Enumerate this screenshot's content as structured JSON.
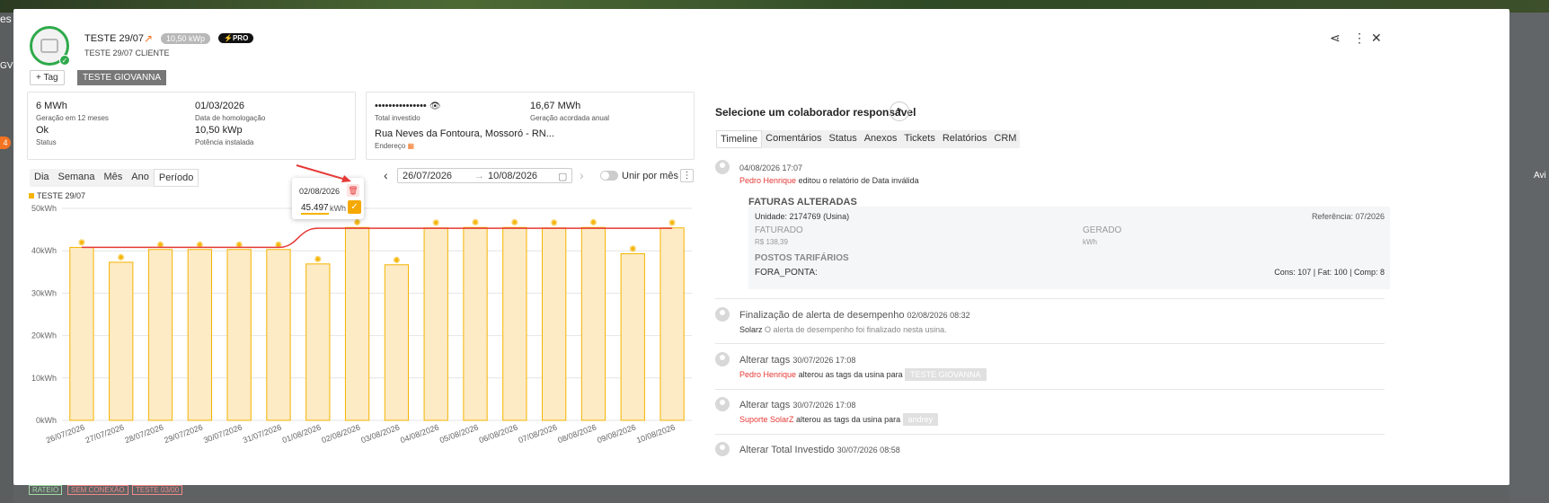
{
  "header": {
    "title": "TESTE 29/07",
    "power_badge": "10,50 kWp",
    "plan_badge": "PRO",
    "client": "TESTE 29/07 CLIENTE",
    "tag_add_label": "Tag",
    "tag": "TESTE GIOVANNA"
  },
  "card1": {
    "gen12_value": "6 MWh",
    "gen12_label": "Geração em 12 meses",
    "homolog_value": "01/03/2026",
    "homolog_label": "Data de homologação",
    "status_value": "Ok",
    "status_label": "Status",
    "power_value": "10,50 kWp",
    "power_label": "Potência instalada"
  },
  "card2": {
    "invest_value": "•••••••••••••••",
    "invest_label": "Total investido",
    "agreed_value": "16,67 MWh",
    "agreed_label": "Geração acordada anual",
    "address_value": "Rua Neves da Fontoura, Mossoró - RN...",
    "address_label": "Endereço"
  },
  "controls": {
    "periods": [
      "Dia",
      "Semana",
      "Mês",
      "Ano",
      "Período"
    ],
    "date_from": "26/07/2026",
    "date_to": "10/08/2026",
    "group_label": "Unir por mês"
  },
  "popup": {
    "date": "02/08/2026",
    "value": "45.497",
    "unit": "kWh"
  },
  "chart_data": {
    "type": "bar",
    "legend": [
      "TESTE 29/07"
    ],
    "categories": [
      "26/07/2026",
      "27/07/2026",
      "28/07/2026",
      "29/07/2026",
      "30/07/2026",
      "31/07/2026",
      "01/08/2026",
      "02/08/2026",
      "03/08/2026",
      "04/08/2026",
      "05/08/2026",
      "06/08/2026",
      "07/08/2026",
      "08/08/2026",
      "09/08/2026",
      "10/08/2026"
    ],
    "series": [
      {
        "name": "TESTE 29/07",
        "values": [
          40.8,
          37.3,
          40.3,
          40.3,
          40.3,
          40.3,
          36.9,
          45.5,
          36.7,
          45.4,
          45.5,
          45.5,
          45.4,
          45.5,
          39.3,
          45.4
        ]
      }
    ],
    "target_line": [
      40.8,
      40.8,
      40.8,
      40.8,
      40.8,
      40.8,
      45.3,
      45.3,
      45.3,
      45.3,
      45.3,
      45.3,
      45.3,
      45.3,
      45.3,
      45.3
    ],
    "yticks": [
      "0kWh",
      "10kWh",
      "20kWh",
      "30kWh",
      "40kWh",
      "50kWh"
    ],
    "ylim": [
      0,
      50
    ],
    "grid": true,
    "colors": {
      "bar_fill": "#fdebc6",
      "bar_stroke": "#f5b400",
      "line": "#e53935",
      "icon": "#f5b400"
    }
  },
  "right": {
    "title": "Selecione um colaborador responsável",
    "tabs": [
      "Timeline",
      "Comentários",
      "Status",
      "Anexos",
      "Tickets",
      "Relatórios",
      "CRM"
    ]
  },
  "timeline": {
    "e1_time": "04/08/2026 17:07",
    "e1_user": "Pedro Henrique",
    "e1_text": "editou o relatório de Data inválida",
    "inv_title": "FATURAS ALTERADAS",
    "inv_unit": "Unidade: 2174769 (Usina)",
    "inv_ref": "Referência: 07/2026",
    "inv_billed_label": "FATURADO",
    "inv_billed_value": "R$ 138,39",
    "inv_gen_label": "GERADO",
    "inv_gen_value": "kWh",
    "inv_posts": "POSTOS TARIFÁRIOS",
    "inv_post_name": "FORA_PONTA:",
    "inv_post_value": "Cons: 107 | Fat: 100 | Comp: 8",
    "e2_title": "Finalização de alerta de desempenho",
    "e2_time": "02/08/2026 08:32",
    "e2_user": "Solarz",
    "e2_text": "O alerta de desempenho foi finalizado nesta usina.",
    "e3_title": "Alterar tags",
    "e3_time": "30/07/2026 17:08",
    "e3_user": "Pedro Henrique",
    "e3_text": "alterou as tags da usina para",
    "e3_tag": "TESTE GIOVANNA",
    "e4_title": "Alterar tags",
    "e4_time": "30/07/2026 17:08",
    "e4_user": "Suporte SolarZ",
    "e4_text": "alterou as tags da usina para",
    "e4_tag": "andrey",
    "e5_title": "Alterar Total Investido",
    "e5_time": "30/07/2026 08:58"
  },
  "background": {
    "left_text": [
      "es",
      "GV"
    ],
    "left_badge": "4",
    "right_text": "Avi",
    "bottom_tags": [
      "RATEIO",
      "SEM CONEXÃO",
      "TESTE 03/00"
    ]
  }
}
